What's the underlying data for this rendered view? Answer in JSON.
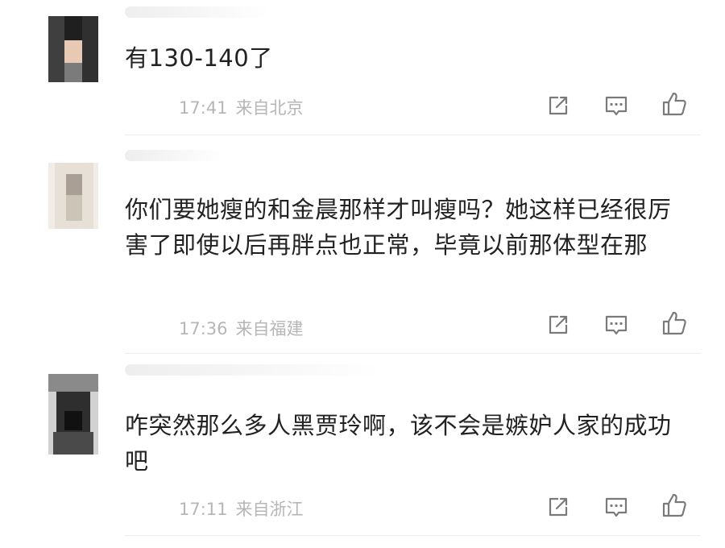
{
  "comments": [
    {
      "text": "有130-140了",
      "time": "17:41",
      "location": "来自北京"
    },
    {
      "text": "你们要她瘦的和金晨那样才叫瘦吗？她这样已经很厉害了即使以后再胖点也正常，毕竟以前那体型在那",
      "time": "17:36",
      "location": "来自福建"
    },
    {
      "text": "咋突然那么多人黑贾玲啊，该不会是嫉妒人家的成功吧",
      "time": "17:11",
      "location": "来自浙江"
    }
  ],
  "icons": {
    "share": "share-icon",
    "reply": "comment-icon",
    "like": "thumbs-up-icon"
  },
  "colors": {
    "text": "#222222",
    "meta": "#b6b6b6",
    "icon": "#7a7a7a",
    "divider": "#ececec"
  }
}
